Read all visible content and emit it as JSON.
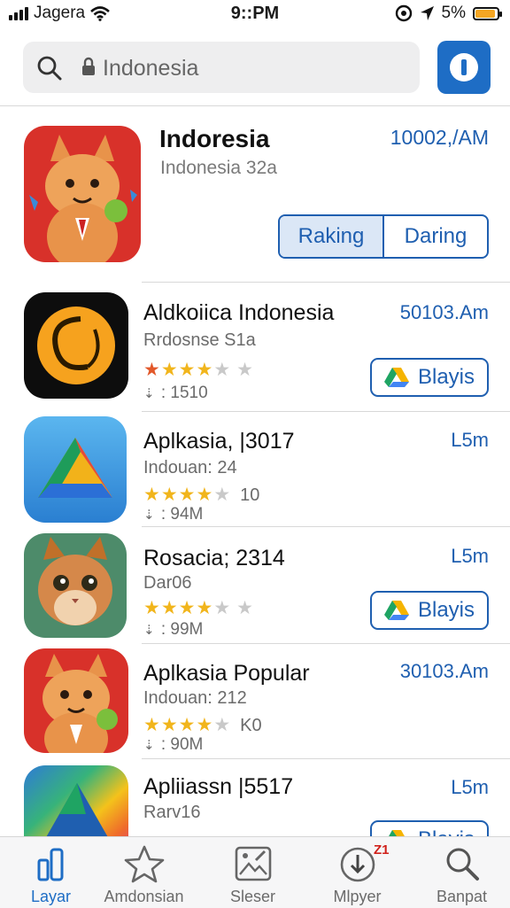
{
  "status_bar": {
    "carrier": "Jagera",
    "time": "9::PM",
    "battery": "5%",
    "battery_level": 0.9
  },
  "search": {
    "placeholder": "Indonesia",
    "value": ""
  },
  "featured": {
    "name": "Indoresia",
    "subtitle": "Indonesia 32a",
    "time": "10002,/AM",
    "segments": [
      "Raking",
      "Daring"
    ],
    "active_segment": 0,
    "icon": "fox-mascot-icon"
  },
  "apps": [
    {
      "name": "Aldkoiica Indonesia",
      "subtitle": "Rrdosnse S1a",
      "time": "50103.Am",
      "rating": 3,
      "rating_count": "",
      "size": "1510",
      "button": "Blayis",
      "icon": "orange-circle-icon"
    },
    {
      "name": "Aplkasia, |3017",
      "subtitle": "Indouan: 24",
      "time": "L5m",
      "rating": 4.5,
      "rating_count": "10",
      "size": "94M",
      "button": "",
      "icon": "triangle-logo-icon"
    },
    {
      "name": "Rosacia; 2314",
      "subtitle": "Dar06",
      "time": "L5m",
      "rating": 4.5,
      "rating_count": "",
      "size": "99M",
      "button": "Blayis",
      "icon": "cat-icon"
    },
    {
      "name": "Aplkasia Popular",
      "subtitle": "Indouan: 212",
      "time": "30103.Am",
      "rating": 4.5,
      "rating_count": "K0",
      "size": "90M",
      "button": "",
      "icon": "fox-mascot-icon"
    },
    {
      "name": "Apliiassn |5517",
      "subtitle": "Rarv16",
      "time": "L5m",
      "rating": 0,
      "rating_count": "",
      "size": "",
      "button": "Blayis",
      "icon": "rainbow-triangle-icon"
    }
  ],
  "tabs": [
    {
      "label": "Layar",
      "icon": "layar-icon",
      "active": true
    },
    {
      "label": "Amdonsian",
      "icon": "star-icon",
      "active": false
    },
    {
      "label": "Sleser",
      "icon": "image-edit-icon",
      "active": false
    },
    {
      "label": "Mlpyer",
      "icon": "download-icon",
      "active": false,
      "badge": "Z1"
    },
    {
      "label": "Banpat",
      "icon": "search-icon",
      "active": false
    }
  ],
  "colors": {
    "accent": "#1e6dc5",
    "link": "#1f5fb0",
    "star": "#f1b51c",
    "battery": "#f5a623"
  }
}
